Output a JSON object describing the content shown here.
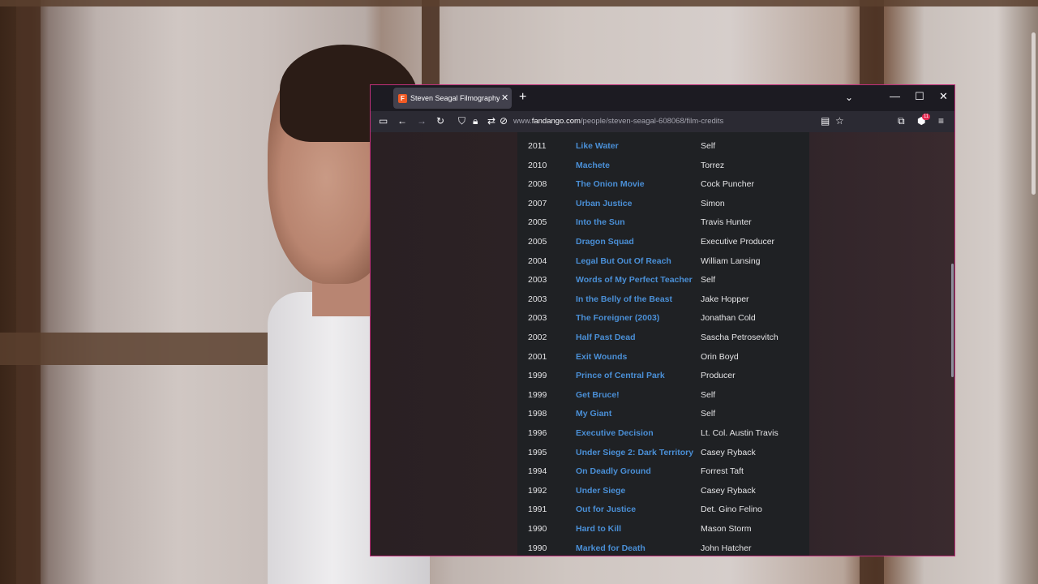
{
  "browser": {
    "tab_title": "Steven Seagal Filmography and",
    "favicon_letter": "F",
    "url_prefix": "www.",
    "url_host": "fandango.com",
    "url_path": "/people/steven-seagal-608068/film-credits",
    "extension_badge": "11",
    "icons": {
      "sidebar": "sidebar-icon",
      "back": "back-arrow-icon",
      "forward": "forward-arrow-icon",
      "reload": "reload-icon",
      "shield": "shield-icon",
      "lock": "lock-icon",
      "permissions": "permissions-icon",
      "tracking": "tracking-icon",
      "reader": "reader-view-icon",
      "bookmark": "bookmark-star-icon",
      "extensions": "extensions-icon",
      "menu": "hamburger-menu-icon"
    },
    "accent_color": "#c0307a"
  },
  "credits": [
    {
      "year": "2011",
      "title": "Like Water",
      "role": "Self"
    },
    {
      "year": "2010",
      "title": "Machete",
      "role": "Torrez"
    },
    {
      "year": "2008",
      "title": "The Onion Movie",
      "role": "Cock Puncher"
    },
    {
      "year": "2007",
      "title": "Urban Justice",
      "role": "Simon"
    },
    {
      "year": "2005",
      "title": "Into the Sun",
      "role": "Travis Hunter"
    },
    {
      "year": "2005",
      "title": "Dragon Squad",
      "role": "Executive Producer"
    },
    {
      "year": "2004",
      "title": "Legal But Out Of Reach",
      "role": "William Lansing"
    },
    {
      "year": "2003",
      "title": "Words of My Perfect Teacher",
      "role": "Self"
    },
    {
      "year": "2003",
      "title": "In the Belly of the Beast",
      "role": "Jake Hopper"
    },
    {
      "year": "2003",
      "title": "The Foreigner (2003)",
      "role": "Jonathan Cold"
    },
    {
      "year": "2002",
      "title": "Half Past Dead",
      "role": "Sascha Petrosevitch"
    },
    {
      "year": "2001",
      "title": "Exit Wounds",
      "role": "Orin Boyd"
    },
    {
      "year": "1999",
      "title": "Prince of Central Park",
      "role": "Producer"
    },
    {
      "year": "1999",
      "title": "Get Bruce!",
      "role": "Self"
    },
    {
      "year": "1998",
      "title": "My Giant",
      "role": "Self"
    },
    {
      "year": "1996",
      "title": "Executive Decision",
      "role": "Lt. Col. Austin Travis"
    },
    {
      "year": "1995",
      "title": "Under Siege 2: Dark Territory",
      "role": "Casey Ryback"
    },
    {
      "year": "1994",
      "title": "On Deadly Ground",
      "role": "Forrest Taft"
    },
    {
      "year": "1992",
      "title": "Under Siege",
      "role": "Casey Ryback"
    },
    {
      "year": "1991",
      "title": "Out for Justice",
      "role": "Det. Gino Felino"
    },
    {
      "year": "1990",
      "title": "Hard to Kill",
      "role": "Mason Storm"
    },
    {
      "year": "1990",
      "title": "Marked for Death",
      "role": "John Hatcher"
    }
  ]
}
